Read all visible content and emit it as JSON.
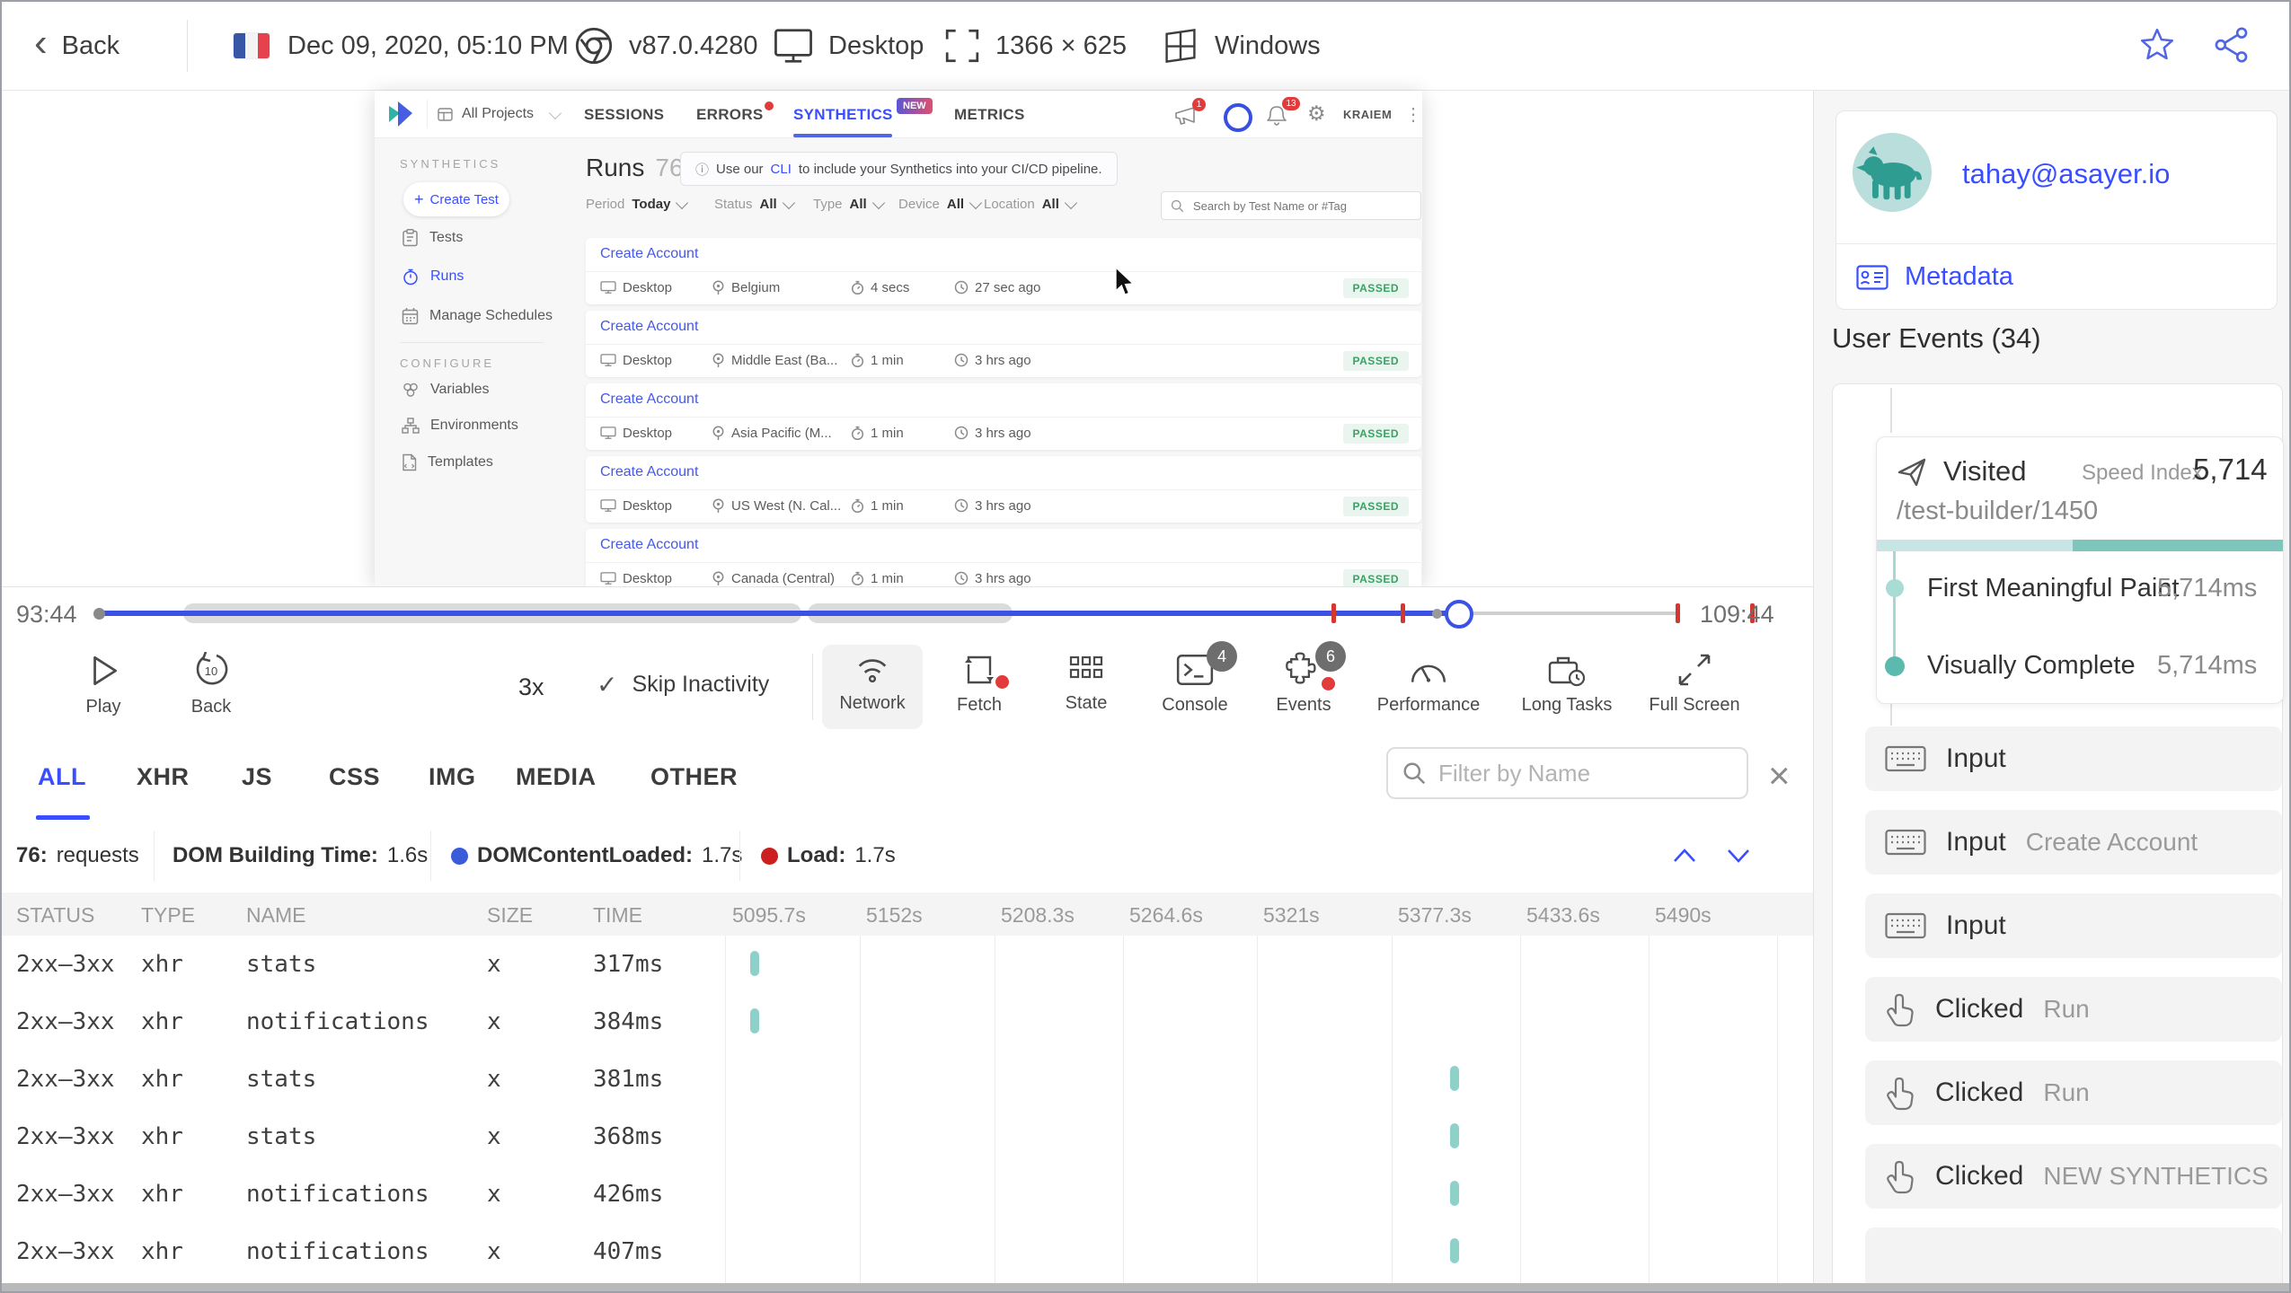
{
  "colors": {
    "accent": "#394eff",
    "teal_bar": "#8ed1c9",
    "passed_bg": "#e9f5ee",
    "passed_text": "#3aa264",
    "red_marker": "#d3372f",
    "dcl_dot": "#3b5bdb",
    "load_dot": "#cc1f1f",
    "avatar_bg": "#b9dedb",
    "avatar_fg": "#2f9c92"
  },
  "icons": {
    "back_chevron": "‹",
    "plus": "+",
    "info": "ⓘ",
    "check": "✓",
    "close": "×",
    "gear": "⚙",
    "overflow_dots": "⋮"
  },
  "top_bar": {
    "back_label": "Back",
    "session_date": "Dec 09, 2020, 05:10 PM",
    "browser_version": "v87.0.4280",
    "device": "Desktop",
    "resolution": "1366 × 625",
    "os": "Windows"
  },
  "app": {
    "nav": {
      "project_selector": "All Projects",
      "tabs": [
        "SESSIONS",
        "ERRORS",
        "SYNTHETICS",
        "METRICS"
      ],
      "new_badge": "NEW",
      "announce_badge": "1",
      "bell_badge": "13",
      "user": "KRAIEM"
    },
    "sidebar": {
      "section_synthetics": "SYNTHETICS",
      "create_test": "Create Test",
      "items": [
        "Tests",
        "Runs",
        "Manage Schedules"
      ],
      "section_configure": "CONFIGURE",
      "config_items": [
        "Variables",
        "Environments",
        "Templates"
      ]
    },
    "runs": {
      "title": "Runs",
      "count": "76",
      "banner_pre": "Use our ",
      "banner_link": "CLI",
      "banner_post": " to include your Synthetics into your CI/CD pipeline.",
      "filters": [
        {
          "label": "Period",
          "value": "Today"
        },
        {
          "label": "Status",
          "value": "All"
        },
        {
          "label": "Type",
          "value": "All"
        },
        {
          "label": "Device",
          "value": "All"
        },
        {
          "label": "Location",
          "value": "All"
        }
      ],
      "search_placeholder": "Search by Test Name or #Tag",
      "rows": [
        {
          "name": "Create Account",
          "device": "Desktop",
          "location": "Belgium",
          "duration": "4 secs",
          "ago": "27 sec ago",
          "status": "PASSED"
        },
        {
          "name": "Create Account",
          "device": "Desktop",
          "location": "Middle East (Ba...",
          "duration": "1 min",
          "ago": "3 hrs ago",
          "status": "PASSED"
        },
        {
          "name": "Create Account",
          "device": "Desktop",
          "location": "Asia Pacific (M...",
          "duration": "1 min",
          "ago": "3 hrs ago",
          "status": "PASSED"
        },
        {
          "name": "Create Account",
          "device": "Desktop",
          "location": "US West (N. Cal...",
          "duration": "1 min",
          "ago": "3 hrs ago",
          "status": "PASSED"
        },
        {
          "name": "Create Account",
          "device": "Desktop",
          "location": "Canada (Central)",
          "duration": "1 min",
          "ago": "3 hrs ago",
          "status": "PASSED"
        }
      ]
    }
  },
  "player": {
    "time_current": "93:44",
    "time_total": "109:44",
    "controls": {
      "play_label": "Play",
      "back_label": "Back",
      "back_step": "10",
      "speed": "3x",
      "skip_label": "Skip Inactivity",
      "network": "Network",
      "fetch": "Fetch",
      "state": "State",
      "console": "Console",
      "console_badge": "4",
      "events": "Events",
      "events_badge": "6",
      "performance": "Performance",
      "long_tasks": "Long Tasks",
      "full_screen": "Full Screen"
    }
  },
  "network": {
    "tabs": [
      "ALL",
      "XHR",
      "JS",
      "CSS",
      "IMG",
      "MEDIA",
      "OTHER"
    ],
    "filter_placeholder": "Filter by Name",
    "summary": {
      "requests_bold": "76:",
      "requests_label": "requests",
      "dom_label": "DOM Building Time:",
      "dom_value": "1.6s",
      "dcl_label": "DOMContentLoaded:",
      "dcl_value": "1.7s",
      "load_label": "Load:",
      "load_value": "1.7s"
    },
    "columns": [
      "STATUS",
      "TYPE",
      "NAME",
      "SIZE",
      "TIME"
    ],
    "time_columns": [
      "5095.7s",
      "5152s",
      "5208.3s",
      "5264.6s",
      "5321s",
      "5377.3s",
      "5433.6s",
      "5490s"
    ],
    "rows": [
      {
        "status": "2xx–3xx",
        "type": "xhr",
        "name": "stats",
        "size": "x",
        "time": "317ms"
      },
      {
        "status": "2xx–3xx",
        "type": "xhr",
        "name": "notifications",
        "size": "x",
        "time": "384ms"
      },
      {
        "status": "2xx–3xx",
        "type": "xhr",
        "name": "stats",
        "size": "x",
        "time": "381ms"
      },
      {
        "status": "2xx–3xx",
        "type": "xhr",
        "name": "stats",
        "size": "x",
        "time": "368ms"
      },
      {
        "status": "2xx–3xx",
        "type": "xhr",
        "name": "notifications",
        "size": "x",
        "time": "426ms"
      },
      {
        "status": "2xx–3xx",
        "type": "xhr",
        "name": "notifications",
        "size": "x",
        "time": "407ms"
      }
    ]
  },
  "user_panel": {
    "email": "tahay@asayer.io",
    "metadata_label": "Metadata",
    "events_title": "User Events (34)",
    "visited": {
      "label": "Visited",
      "speed_index_label": "Speed Index",
      "speed_index": "5,714",
      "path": "/test-builder/1450",
      "metrics": [
        {
          "name": "First Meaningful Paint",
          "value": "5,714ms"
        },
        {
          "name": "Visually Complete",
          "value": "5,714ms"
        }
      ]
    },
    "events": [
      {
        "type": "Input",
        "value": ""
      },
      {
        "type": "Input",
        "value": "Create Account"
      },
      {
        "type": "Input",
        "value": ""
      },
      {
        "type": "Clicked",
        "value": "Run"
      },
      {
        "type": "Clicked",
        "value": "Run"
      },
      {
        "type": "Clicked",
        "value": "NEW SYNTHETICS"
      }
    ]
  }
}
